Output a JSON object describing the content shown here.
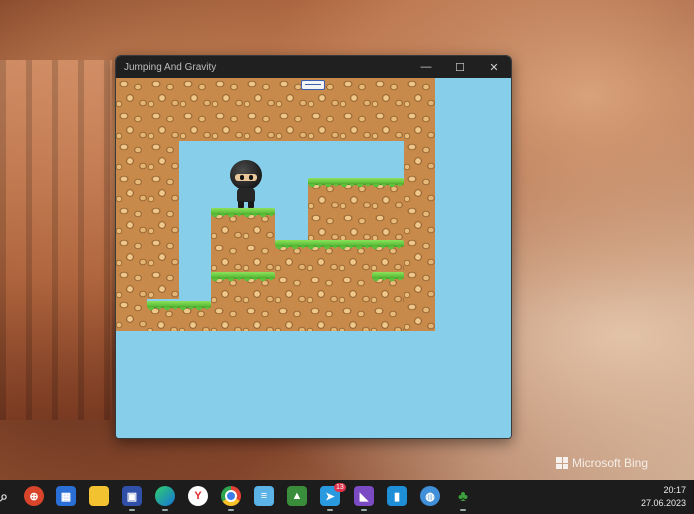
{
  "window": {
    "title": "Jumping And Gravity",
    "controls": {
      "minimize": "—",
      "maximize": "☐",
      "close": "✕"
    }
  },
  "game": {
    "background_color": "#87ceeb",
    "player": "ninja"
  },
  "wallpaper": {
    "watermark": "Microsoft Bing"
  },
  "taskbar": {
    "icons": [
      "search-icon",
      "remote-desktop-icon",
      "store-icon",
      "file-explorer-icon",
      "floppy-app-icon",
      "edge-icon",
      "yandex-icon",
      "chrome-icon",
      "notepad-icon",
      "image-editor-icon",
      "telegram-icon",
      "visual-studio-icon",
      "app-icon",
      "globe-app-icon",
      "tree-app-icon"
    ],
    "notification_count": "13",
    "time": "20:17",
    "date": "27.06.2023"
  }
}
